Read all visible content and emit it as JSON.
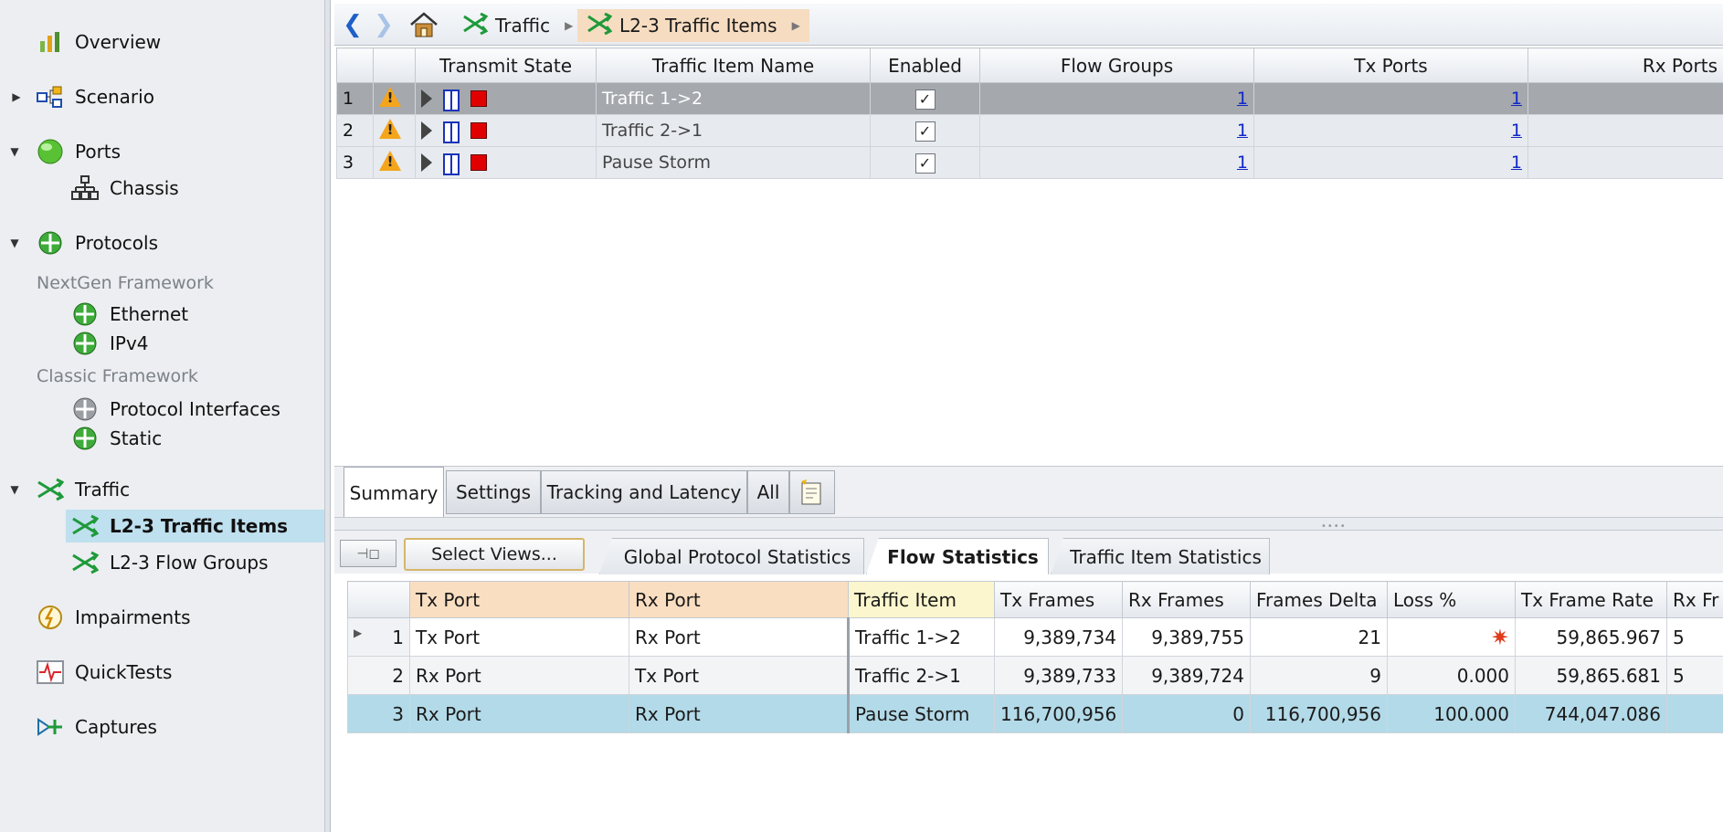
{
  "sidebar": {
    "items": [
      {
        "label": "Overview",
        "icon": "bar-chart-icon"
      },
      {
        "label": "Scenario",
        "icon": "scenario-icon"
      },
      {
        "label": "Ports",
        "icon": "port-globe-icon"
      },
      {
        "label": "Chassis",
        "icon": "chassis-icon"
      },
      {
        "label": "Protocols",
        "icon": "protocol-icon"
      },
      {
        "label": "Ethernet",
        "icon": "protocol-icon"
      },
      {
        "label": "IPv4",
        "icon": "protocol-icon"
      },
      {
        "label": "Protocol Interfaces",
        "icon": "protocol-gray-icon"
      },
      {
        "label": "Static",
        "icon": "protocol-icon"
      },
      {
        "label": "Traffic",
        "icon": "traffic-icon"
      },
      {
        "label": "L2-3 Traffic Items",
        "icon": "traffic-icon"
      },
      {
        "label": "L2-3 Flow Groups",
        "icon": "traffic-icon"
      },
      {
        "label": "Impairments",
        "icon": "impairment-icon"
      },
      {
        "label": "QuickTests",
        "icon": "quicktest-icon"
      },
      {
        "label": "Captures",
        "icon": "capture-icon"
      }
    ],
    "groups": {
      "nextgen": "NextGen Framework",
      "classic": "Classic Framework"
    }
  },
  "breadcrumb": {
    "crumbs": [
      "Traffic",
      "L2-3 Traffic Items"
    ]
  },
  "traffic_items": {
    "columns": [
      "Transmit State",
      "Traffic Item Name",
      "Enabled",
      "Flow Groups",
      "Tx Ports",
      "Rx Ports"
    ],
    "rows": [
      {
        "num": "1",
        "name": "Traffic 1->2",
        "enabled": "✓",
        "flow_groups": "1",
        "tx_ports": "1"
      },
      {
        "num": "2",
        "name": "Traffic 2->1",
        "enabled": "✓",
        "flow_groups": "1",
        "tx_ports": "1"
      },
      {
        "num": "3",
        "name": "Pause Storm",
        "enabled": "✓",
        "flow_groups": "1",
        "tx_ports": "1"
      }
    ]
  },
  "detail_tabs": [
    "Summary",
    "Settings",
    "Tracking and Latency",
    "All"
  ],
  "stats": {
    "select_views_label": "Select Views...",
    "view_tabs": [
      "Global Protocol Statistics",
      "Flow Statistics",
      "Traffic Item Statistics"
    ],
    "columns": [
      "Tx Port",
      "Rx Port",
      "Traffic Item",
      "Tx Frames",
      "Rx Frames",
      "Frames Delta",
      "Loss %",
      "Tx Frame Rate",
      "Rx Fr"
    ],
    "rows": [
      {
        "num": "1",
        "tx_port": "Tx Port",
        "rx_port": "Rx Port",
        "traffic_item": "Traffic 1->2",
        "tx_frames": "9,389,734",
        "rx_frames": "9,389,755",
        "frames_delta": "21",
        "loss": "✷",
        "tx_rate": "59,865.967",
        "rx_rate": "5"
      },
      {
        "num": "2",
        "tx_port": "Rx Port",
        "rx_port": "Tx Port",
        "traffic_item": "Traffic 2->1",
        "tx_frames": "9,389,733",
        "rx_frames": "9,389,724",
        "frames_delta": "9",
        "loss": "0.000",
        "tx_rate": "59,865.681",
        "rx_rate": "5"
      },
      {
        "num": "3",
        "tx_port": "Rx Port",
        "rx_port": "Rx Port",
        "traffic_item": "Pause Storm",
        "tx_frames": "116,700,956",
        "rx_frames": "0",
        "frames_delta": "116,700,956",
        "loss": "100.000",
        "tx_rate": "744,047.086",
        "rx_rate": ""
      }
    ]
  }
}
